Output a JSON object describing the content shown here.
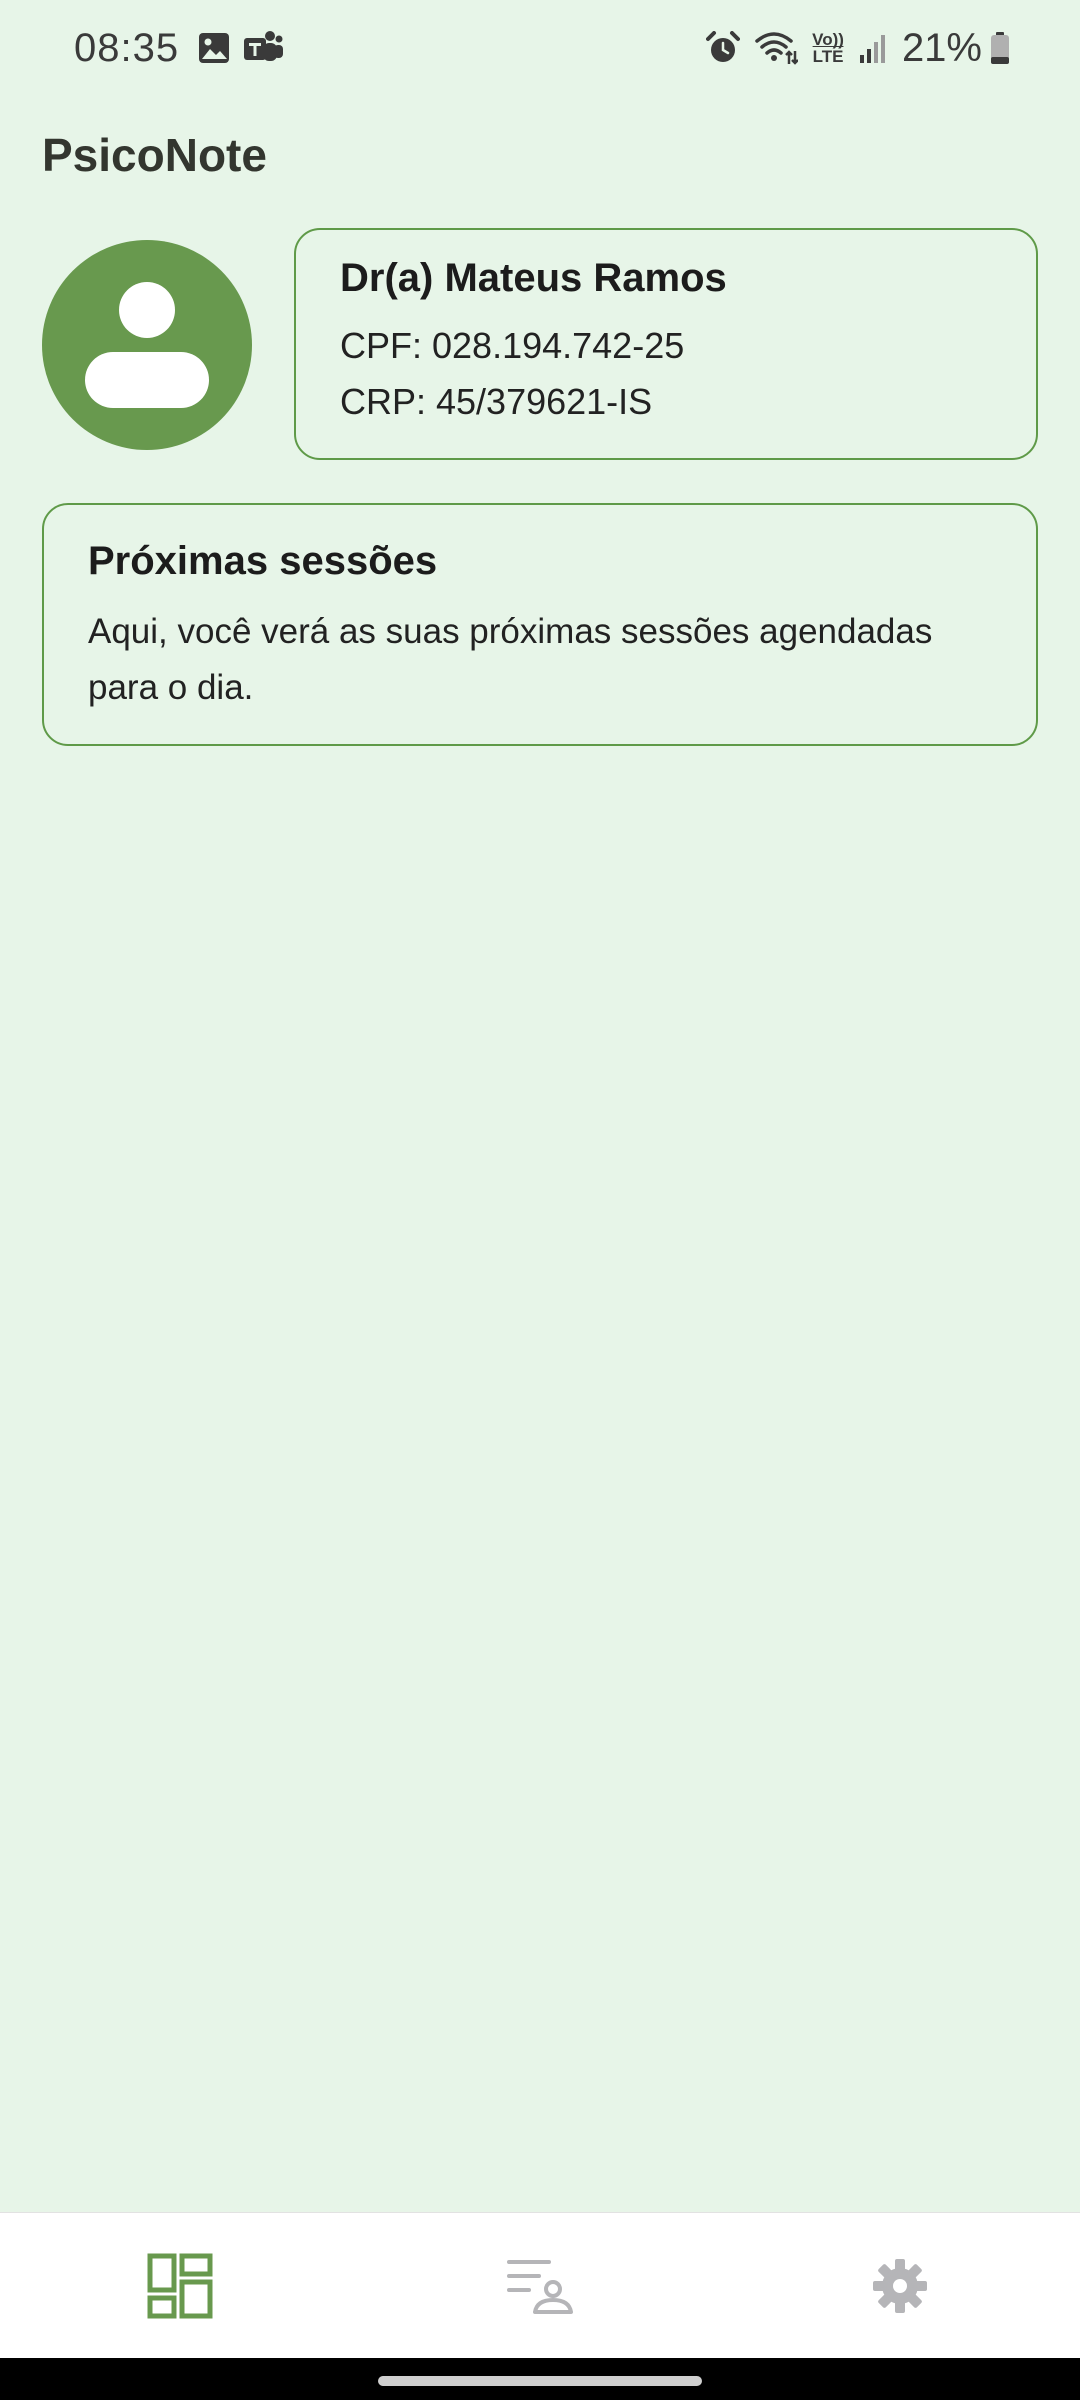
{
  "status_bar": {
    "time": "08:35",
    "left_icons": [
      "gallery-icon",
      "teams-icon"
    ],
    "right_icons": [
      "alarm-icon",
      "wifi-icon",
      "volte-icon",
      "signal-icon"
    ],
    "volte_top": "Vo))",
    "volte_bottom": "LTE",
    "battery_percent": "21%"
  },
  "app": {
    "title": "PsicoNote"
  },
  "profile": {
    "avatar_icon": "person-icon",
    "name": "Dr(a) Mateus Ramos",
    "cpf": "CPF: 028.194.742-25",
    "crp": "CRP: 45/379621-IS"
  },
  "sessions": {
    "title": "Próximas sessões",
    "description": "Aqui, você verá as suas próximas sessões agendadas para o dia."
  },
  "bottom_nav": {
    "items": [
      {
        "icon": "dashboard-icon",
        "active": true
      },
      {
        "icon": "patients-list-icon",
        "active": false
      },
      {
        "icon": "gear-icon",
        "active": false
      }
    ]
  },
  "colors": {
    "background": "#e7f5e8",
    "accent": "#68994e",
    "card_border": "#5f9a48",
    "nav_inactive": "#b5b5b8"
  }
}
